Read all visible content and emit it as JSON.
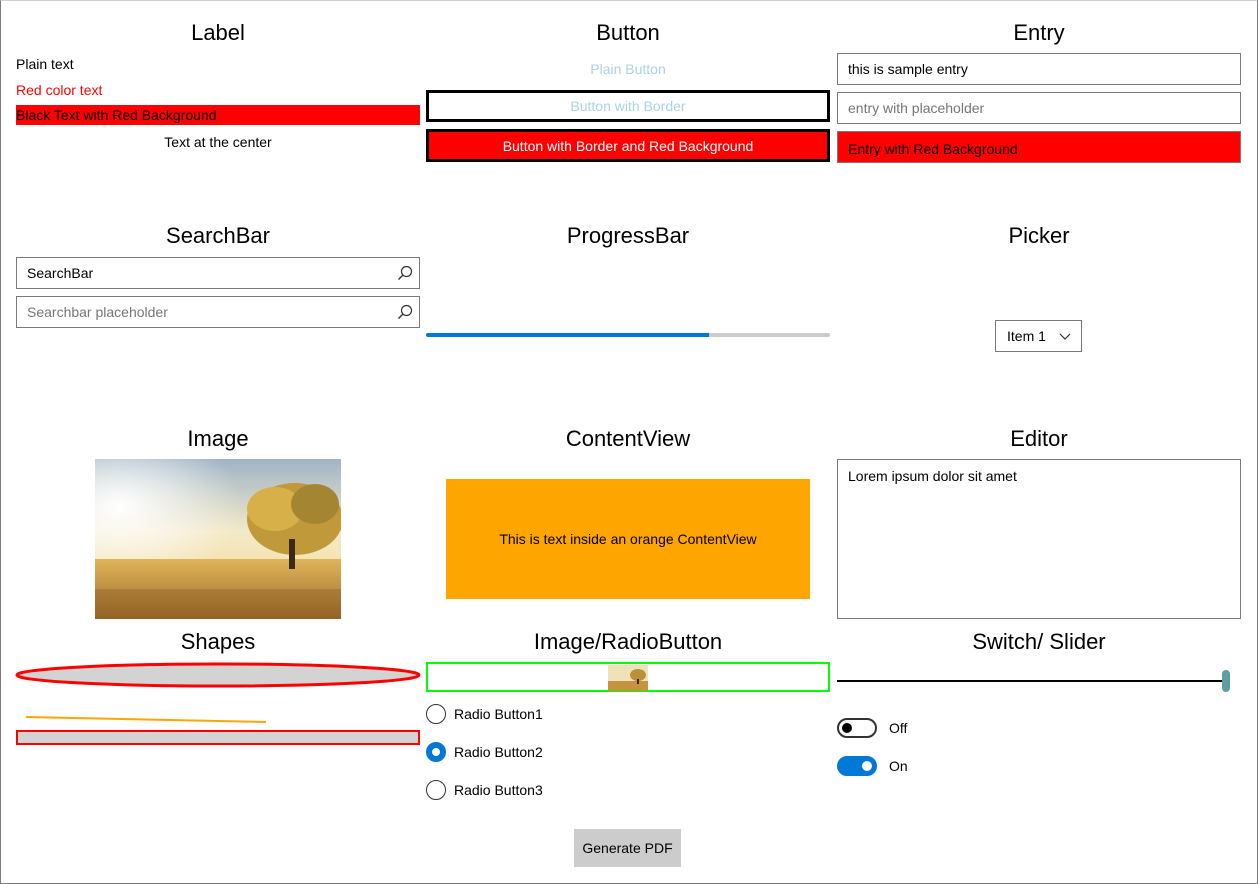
{
  "sections": {
    "label": "Label",
    "button": "Button",
    "entry": "Entry",
    "searchbar": "SearchBar",
    "progressbar": "ProgressBar",
    "picker": "Picker",
    "image": "Image",
    "contentview": "ContentView",
    "editor": "Editor",
    "shapes": "Shapes",
    "image_radio": "Image/RadioButton",
    "switch_slider": "Switch/ Slider"
  },
  "labels": {
    "plain": "Plain text",
    "red": "Red color text",
    "red_bg": "Black Text with Red Background",
    "center": "Text at the center"
  },
  "buttons": {
    "plain": "Plain Button",
    "border": "Button with Border",
    "border_red": "Button with Border and Red Background"
  },
  "entries": {
    "sample_value": "this is sample entry",
    "placeholder": "entry with placeholder",
    "red_bg_value": "Entry with Red Background"
  },
  "searchbars": {
    "value": "SearchBar",
    "placeholder": "Searchbar placeholder"
  },
  "progress": {
    "value": 0.7
  },
  "picker": {
    "selected": "Item 1"
  },
  "contentview": {
    "text": "This is text inside an orange ContentView"
  },
  "editor": {
    "text": "Lorem ipsum dolor sit amet"
  },
  "radios": [
    {
      "label": "Radio Button1",
      "checked": false
    },
    {
      "label": "Radio Button2",
      "checked": true
    },
    {
      "label": "Radio Button3",
      "checked": false
    }
  ],
  "slider": {
    "value": 1.0
  },
  "switches": [
    {
      "label": "Off",
      "on": false
    },
    {
      "label": "On",
      "on": true
    }
  ],
  "footer": {
    "generate_pdf": "Generate PDF"
  },
  "colors": {
    "accent": "#0078d7",
    "red": "#ff0000",
    "orange": "#ffa500",
    "green": "#00ff00",
    "light_blue_text": "#a9d3e6",
    "slider_thumb": "#5f9ea0"
  }
}
